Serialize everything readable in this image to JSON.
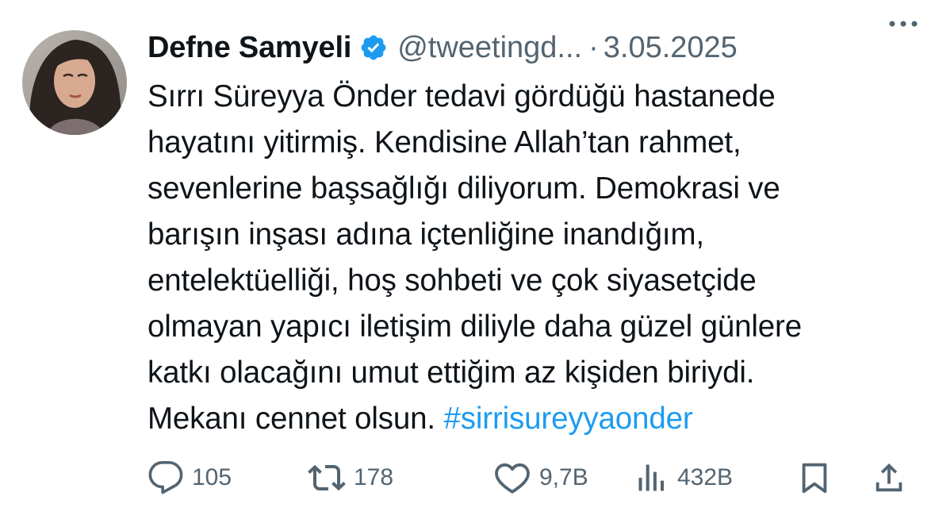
{
  "tweet": {
    "display_name": "Defne Samyeli",
    "handle": "@tweetingd...",
    "separator": "·",
    "date": "3.05.2025",
    "text_plain": "Sırrı Süreyya Önder tedavi gördüğü hastanede\nhayatını yitirmiş. Kendisine Allah’tan rahmet,\nsevenlerine başsağlığı diliyorum. Demokrasi ve\nbarışın inşası adına içtenliğine inandığım,\nentelektüelliği, hoş sohbeti ve çok siyasetçide\nolmayan yapıcı iletişim diliyle daha güzel günlere\nkatkı olacağını umut ettiğim az kişiden biriydi.\nMekanı cennet olsun. ",
    "hashtag": "#sirrisureyyaonder"
  },
  "actions": {
    "replies": "105",
    "reposts": "178",
    "likes": "9,7B",
    "views": "432B"
  },
  "icons": {
    "verified": "verified-badge-icon",
    "more": "more-dots-icon",
    "reply": "reply-icon",
    "repost": "repost-icon",
    "like": "heart-icon",
    "views": "views-bar-icon",
    "bookmark": "bookmark-icon",
    "share": "share-icon"
  },
  "colors": {
    "text": "#0f1419",
    "secondary": "#536471",
    "accent": "#1d9bf0"
  }
}
